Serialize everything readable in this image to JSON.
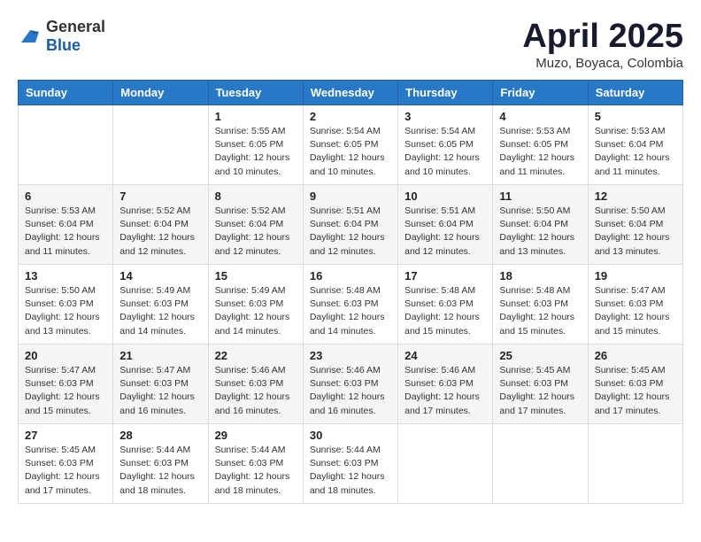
{
  "logo": {
    "general": "General",
    "blue": "Blue"
  },
  "header": {
    "title": "April 2025",
    "subtitle": "Muzo, Boyaca, Colombia"
  },
  "weekdays": [
    "Sunday",
    "Monday",
    "Tuesday",
    "Wednesday",
    "Thursday",
    "Friday",
    "Saturday"
  ],
  "weeks": [
    [
      {
        "day": "",
        "info": ""
      },
      {
        "day": "",
        "info": ""
      },
      {
        "day": "1",
        "info": "Sunrise: 5:55 AM\nSunset: 6:05 PM\nDaylight: 12 hours\nand 10 minutes."
      },
      {
        "day": "2",
        "info": "Sunrise: 5:54 AM\nSunset: 6:05 PM\nDaylight: 12 hours\nand 10 minutes."
      },
      {
        "day": "3",
        "info": "Sunrise: 5:54 AM\nSunset: 6:05 PM\nDaylight: 12 hours\nand 10 minutes."
      },
      {
        "day": "4",
        "info": "Sunrise: 5:53 AM\nSunset: 6:05 PM\nDaylight: 12 hours\nand 11 minutes."
      },
      {
        "day": "5",
        "info": "Sunrise: 5:53 AM\nSunset: 6:04 PM\nDaylight: 12 hours\nand 11 minutes."
      }
    ],
    [
      {
        "day": "6",
        "info": "Sunrise: 5:53 AM\nSunset: 6:04 PM\nDaylight: 12 hours\nand 11 minutes."
      },
      {
        "day": "7",
        "info": "Sunrise: 5:52 AM\nSunset: 6:04 PM\nDaylight: 12 hours\nand 12 minutes."
      },
      {
        "day": "8",
        "info": "Sunrise: 5:52 AM\nSunset: 6:04 PM\nDaylight: 12 hours\nand 12 minutes."
      },
      {
        "day": "9",
        "info": "Sunrise: 5:51 AM\nSunset: 6:04 PM\nDaylight: 12 hours\nand 12 minutes."
      },
      {
        "day": "10",
        "info": "Sunrise: 5:51 AM\nSunset: 6:04 PM\nDaylight: 12 hours\nand 12 minutes."
      },
      {
        "day": "11",
        "info": "Sunrise: 5:50 AM\nSunset: 6:04 PM\nDaylight: 12 hours\nand 13 minutes."
      },
      {
        "day": "12",
        "info": "Sunrise: 5:50 AM\nSunset: 6:04 PM\nDaylight: 12 hours\nand 13 minutes."
      }
    ],
    [
      {
        "day": "13",
        "info": "Sunrise: 5:50 AM\nSunset: 6:03 PM\nDaylight: 12 hours\nand 13 minutes."
      },
      {
        "day": "14",
        "info": "Sunrise: 5:49 AM\nSunset: 6:03 PM\nDaylight: 12 hours\nand 14 minutes."
      },
      {
        "day": "15",
        "info": "Sunrise: 5:49 AM\nSunset: 6:03 PM\nDaylight: 12 hours\nand 14 minutes."
      },
      {
        "day": "16",
        "info": "Sunrise: 5:48 AM\nSunset: 6:03 PM\nDaylight: 12 hours\nand 14 minutes."
      },
      {
        "day": "17",
        "info": "Sunrise: 5:48 AM\nSunset: 6:03 PM\nDaylight: 12 hours\nand 15 minutes."
      },
      {
        "day": "18",
        "info": "Sunrise: 5:48 AM\nSunset: 6:03 PM\nDaylight: 12 hours\nand 15 minutes."
      },
      {
        "day": "19",
        "info": "Sunrise: 5:47 AM\nSunset: 6:03 PM\nDaylight: 12 hours\nand 15 minutes."
      }
    ],
    [
      {
        "day": "20",
        "info": "Sunrise: 5:47 AM\nSunset: 6:03 PM\nDaylight: 12 hours\nand 15 minutes."
      },
      {
        "day": "21",
        "info": "Sunrise: 5:47 AM\nSunset: 6:03 PM\nDaylight: 12 hours\nand 16 minutes."
      },
      {
        "day": "22",
        "info": "Sunrise: 5:46 AM\nSunset: 6:03 PM\nDaylight: 12 hours\nand 16 minutes."
      },
      {
        "day": "23",
        "info": "Sunrise: 5:46 AM\nSunset: 6:03 PM\nDaylight: 12 hours\nand 16 minutes."
      },
      {
        "day": "24",
        "info": "Sunrise: 5:46 AM\nSunset: 6:03 PM\nDaylight: 12 hours\nand 17 minutes."
      },
      {
        "day": "25",
        "info": "Sunrise: 5:45 AM\nSunset: 6:03 PM\nDaylight: 12 hours\nand 17 minutes."
      },
      {
        "day": "26",
        "info": "Sunrise: 5:45 AM\nSunset: 6:03 PM\nDaylight: 12 hours\nand 17 minutes."
      }
    ],
    [
      {
        "day": "27",
        "info": "Sunrise: 5:45 AM\nSunset: 6:03 PM\nDaylight: 12 hours\nand 17 minutes."
      },
      {
        "day": "28",
        "info": "Sunrise: 5:44 AM\nSunset: 6:03 PM\nDaylight: 12 hours\nand 18 minutes."
      },
      {
        "day": "29",
        "info": "Sunrise: 5:44 AM\nSunset: 6:03 PM\nDaylight: 12 hours\nand 18 minutes."
      },
      {
        "day": "30",
        "info": "Sunrise: 5:44 AM\nSunset: 6:03 PM\nDaylight: 12 hours\nand 18 minutes."
      },
      {
        "day": "",
        "info": ""
      },
      {
        "day": "",
        "info": ""
      },
      {
        "day": "",
        "info": ""
      }
    ]
  ]
}
